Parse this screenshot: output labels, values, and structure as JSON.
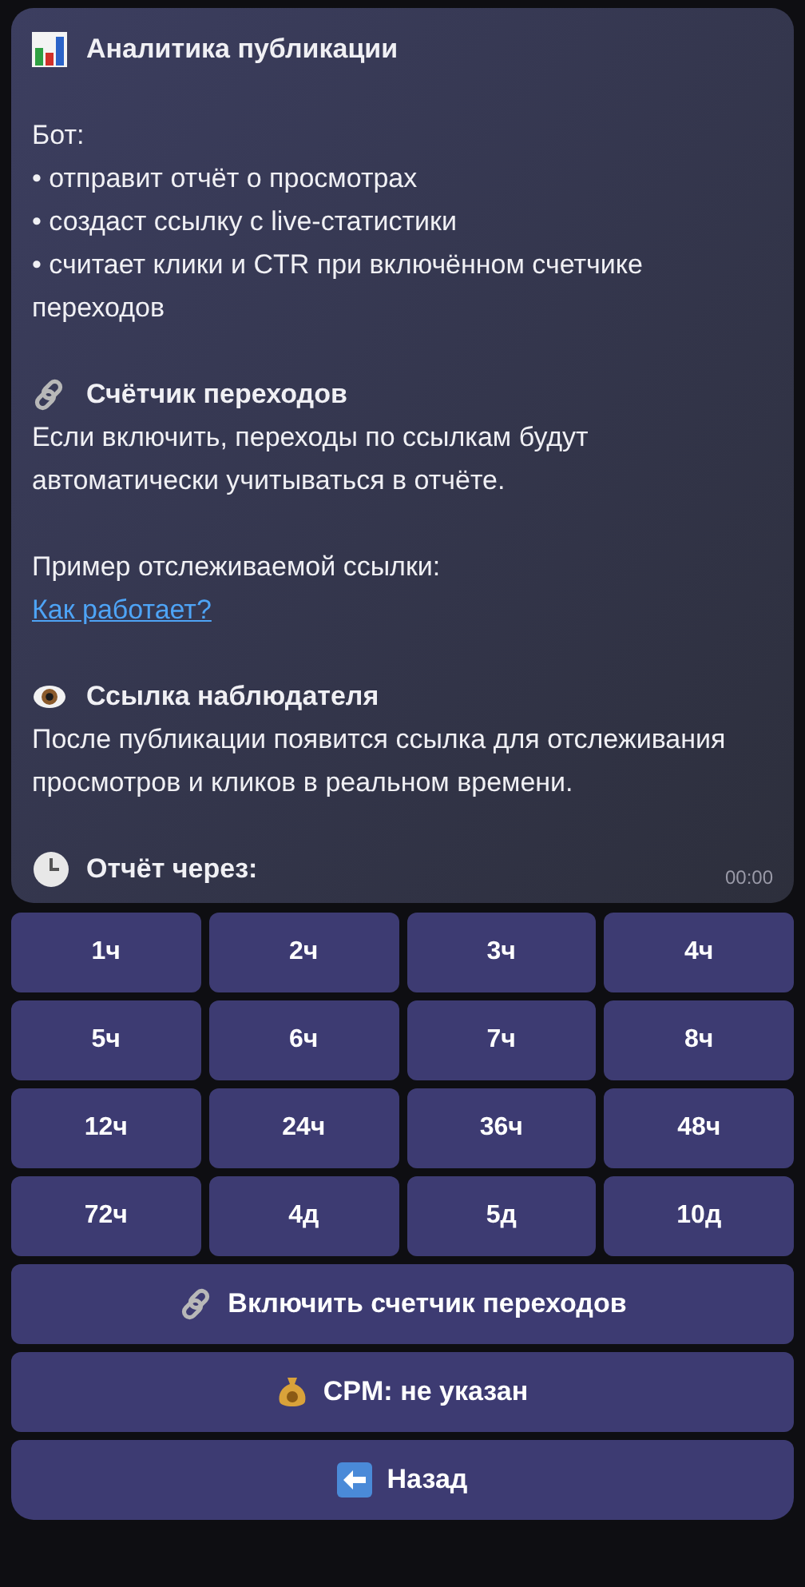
{
  "message": {
    "title": "Аналитика публикации",
    "intro": [
      "Бот:",
      "• отправит отчёт о просмотрах",
      "• создаст ссылку с live-статистики",
      "• считает клики и CTR при включённом счетчике переходов"
    ],
    "counter": {
      "heading": "Счётчик переходов",
      "text": "Если включить, переходы по ссылкам будут автоматически учитываться в отчёте."
    },
    "example": {
      "text": "Пример отслеживаемой ссылки:",
      "link": "Как работает?"
    },
    "watcher": {
      "heading": "Ссылка наблюдателя",
      "text": "После публикации появится ссылка для отслеживания просмотров и кликов в реальном времени."
    },
    "report": {
      "heading": "Отчёт через:"
    },
    "time": "00:00"
  },
  "hour_buttons": [
    "1ч",
    "2ч",
    "3ч",
    "4ч",
    "5ч",
    "6ч",
    "7ч",
    "8ч",
    "12ч",
    "24ч",
    "36ч",
    "48ч",
    "72ч",
    "4д",
    "5д",
    "10д"
  ],
  "action_buttons": [
    {
      "label": "Включить счетчик переходов"
    },
    {
      "label": "CPM: не указан"
    },
    {
      "label": "Назад"
    }
  ]
}
